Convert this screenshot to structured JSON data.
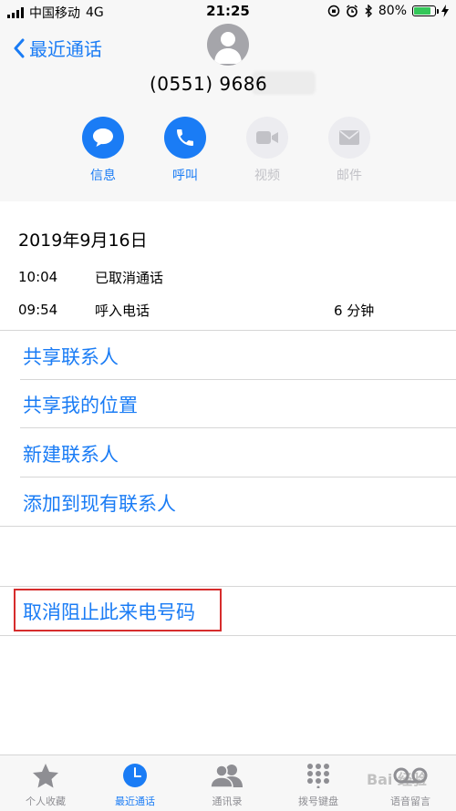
{
  "status_bar": {
    "carrier": "中国移动",
    "network": "4G",
    "time": "21:25",
    "battery_percent": "80%",
    "battery_level": 0.8
  },
  "header": {
    "back_label": "最近通话",
    "phone_number": "(0551) 9686"
  },
  "actions": [
    {
      "label": "信息",
      "icon": "message-icon",
      "enabled": true
    },
    {
      "label": "呼叫",
      "icon": "phone-icon",
      "enabled": true
    },
    {
      "label": "视频",
      "icon": "video-icon",
      "enabled": false
    },
    {
      "label": "邮件",
      "icon": "mail-icon",
      "enabled": false
    }
  ],
  "calls": {
    "date": "2019年9月16日",
    "entries": [
      {
        "time": "10:04",
        "type": "已取消通话",
        "duration": ""
      },
      {
        "time": "09:54",
        "type": "呼入电话",
        "duration": "6 分钟"
      }
    ]
  },
  "links": {
    "share_contact": "共享联系人",
    "share_location": "共享我的位置",
    "new_contact": "新建联系人",
    "add_to_existing": "添加到现有联系人",
    "unblock": "取消阻止此来电号码"
  },
  "tabbar": [
    {
      "label": "个人收藏",
      "icon": "star-icon"
    },
    {
      "label": "最近通话",
      "icon": "clock-icon",
      "active": true
    },
    {
      "label": "通讯录",
      "icon": "contacts-icon"
    },
    {
      "label": "拨号键盘",
      "icon": "keypad-icon"
    },
    {
      "label": "语音留言",
      "icon": "voicemail-icon"
    }
  ],
  "watermark": "Bai 经验",
  "colors": {
    "accent": "#1a7cf5",
    "disabled": "#c2c2c7",
    "highlight_box": "#d62c2c",
    "battery": "#34c759"
  }
}
